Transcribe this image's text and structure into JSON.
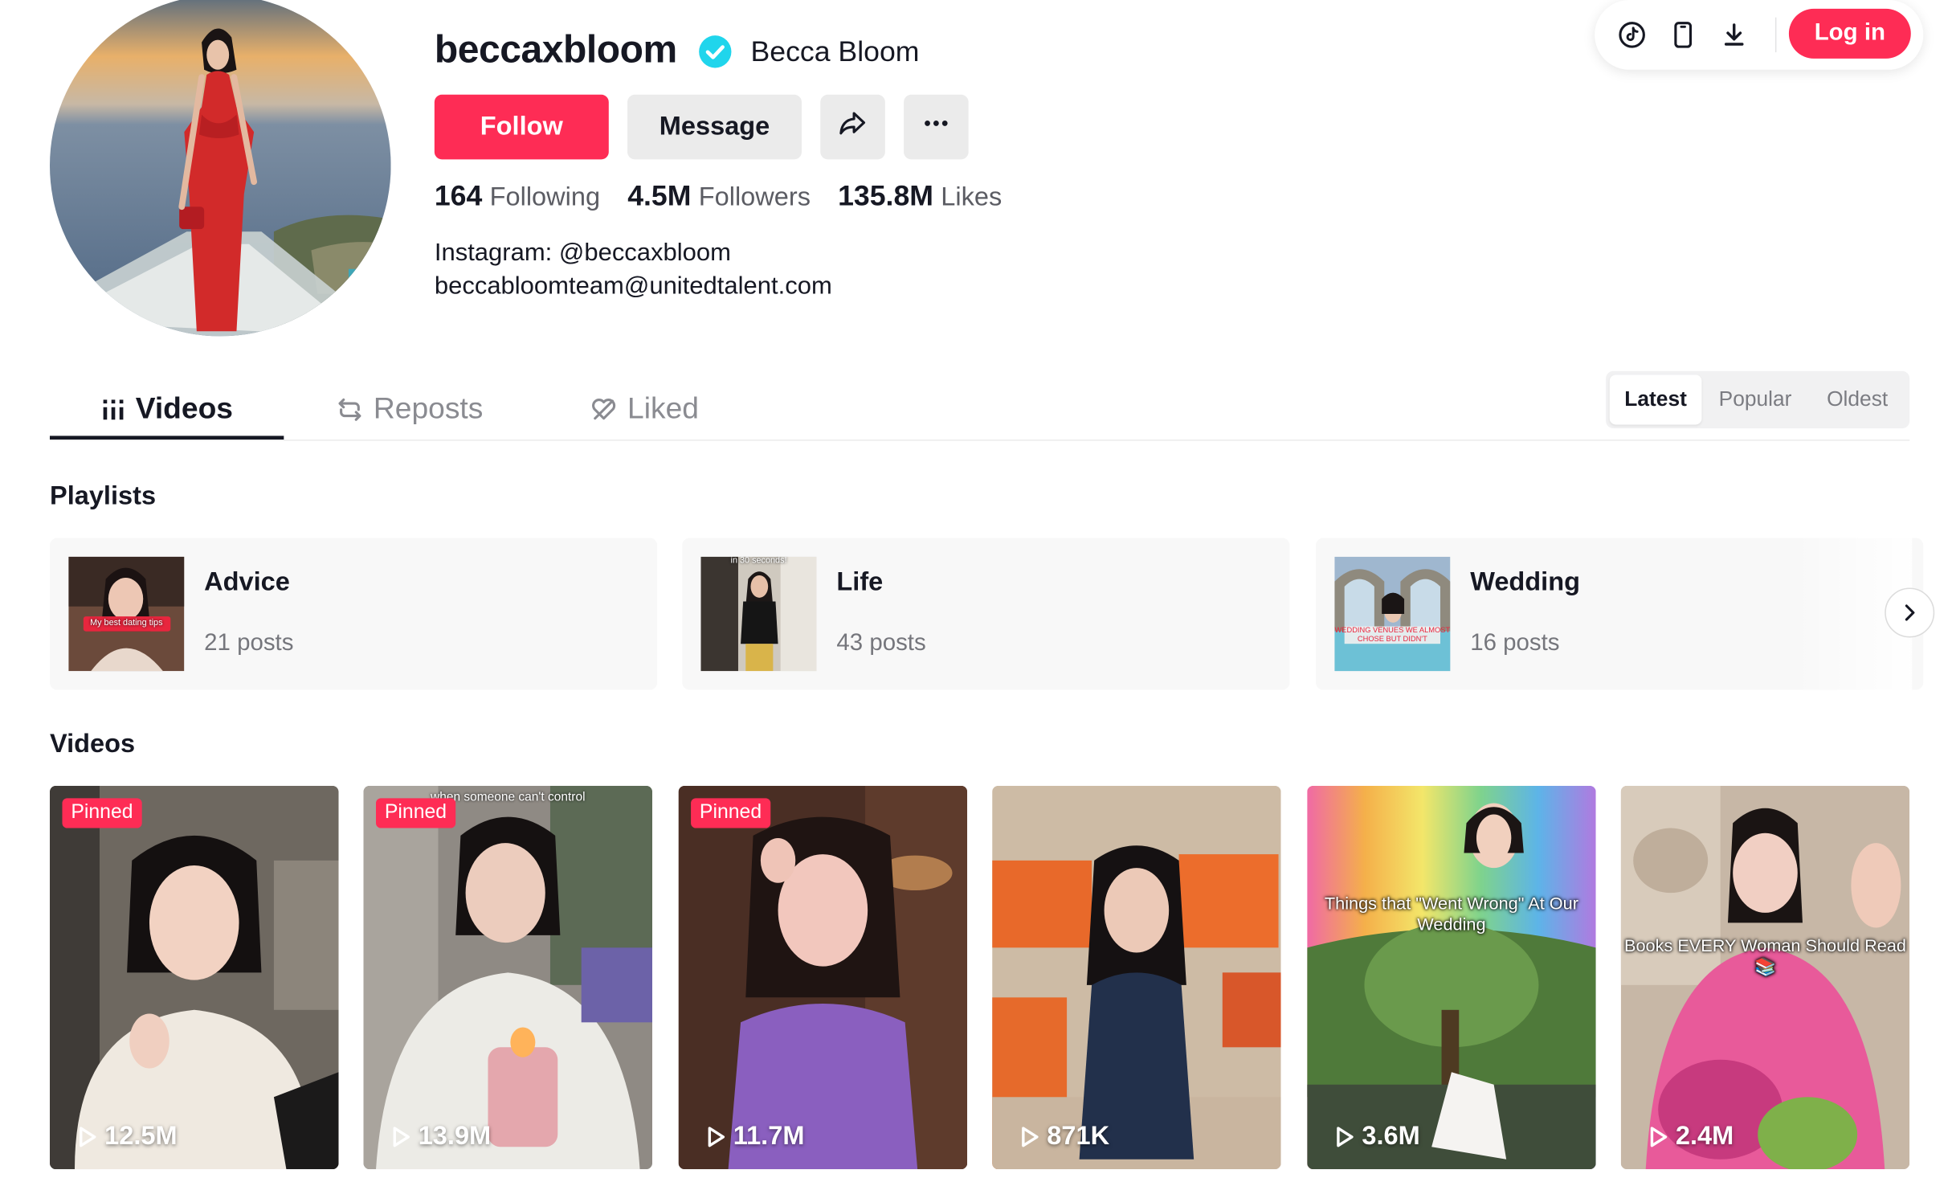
{
  "header": {
    "login_label": "Log in",
    "icons": [
      "tiktok-coin-icon",
      "phone-icon",
      "download-icon"
    ]
  },
  "profile": {
    "username": "beccaxbloom",
    "display_name": "Becca Bloom",
    "verified": true,
    "follow_label": "Follow",
    "message_label": "Message",
    "stats": [
      {
        "value": "164",
        "label": "Following"
      },
      {
        "value": "4.5M",
        "label": "Followers"
      },
      {
        "value": "135.8M",
        "label": "Likes"
      }
    ],
    "bio_line1": "Instagram: @beccaxbloom",
    "bio_line2": "beccabloomteam@unitedtalent.com"
  },
  "tabs": {
    "items": [
      {
        "label": "Videos",
        "active": true
      },
      {
        "label": "Reposts",
        "active": false
      },
      {
        "label": "Liked",
        "active": false
      }
    ],
    "sort": [
      "Latest",
      "Popular",
      "Oldest"
    ],
    "sort_selected": "Latest"
  },
  "playlists": {
    "heading": "Playlists",
    "items": [
      {
        "title": "Advice",
        "count": "21 posts",
        "thumb_caption": "My best dating tips"
      },
      {
        "title": "Life",
        "count": "43 posts",
        "thumb_caption": "in 30 seconds!"
      },
      {
        "title": "Wedding",
        "count": "16 posts",
        "thumb_caption": "WEDDING VENUES WE ALMOST CHOSE BUT DIDN'T"
      }
    ]
  },
  "videos": {
    "heading": "Videos",
    "pinned_label": "Pinned",
    "items": [
      {
        "views": "12.5M",
        "pinned": true,
        "caption": ""
      },
      {
        "views": "13.9M",
        "pinned": true,
        "caption": "when someone can't control"
      },
      {
        "views": "11.7M",
        "pinned": true,
        "caption": ""
      },
      {
        "views": "871K",
        "pinned": false,
        "caption": ""
      },
      {
        "views": "3.6M",
        "pinned": false,
        "caption": "Things that \"Went Wrong\" At Our Wedding"
      },
      {
        "views": "2.4M",
        "pinned": false,
        "caption": "Books EVERY Woman Should Read 📚"
      }
    ]
  },
  "colors": {
    "brand_red": "#fe2c55",
    "verified_blue": "#20d5ec",
    "button_gray": "#ebebeb"
  }
}
